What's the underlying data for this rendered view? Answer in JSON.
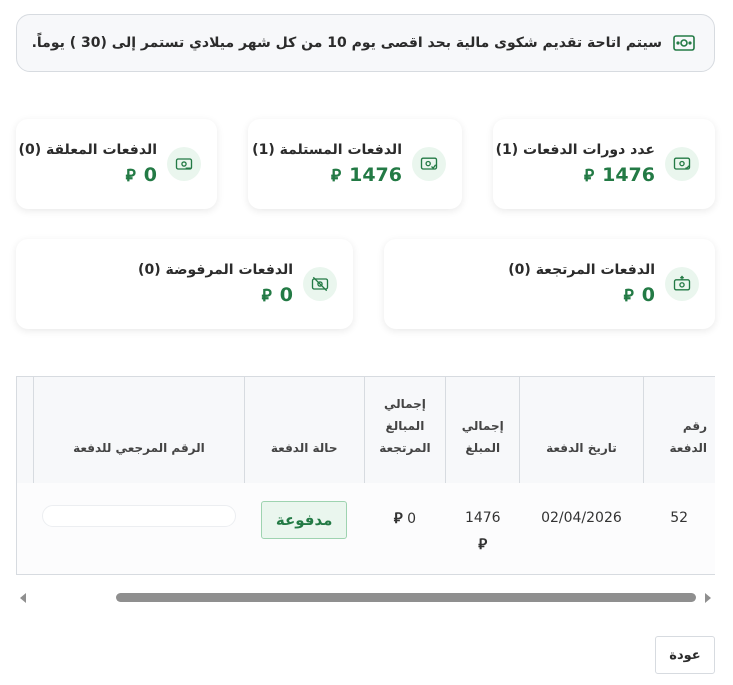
{
  "notice": {
    "text": "سيتم اتاحة تقديم شكوى مالية بحد اقصى يوم 10 من كل شهر ميلادي تستمر إلى (30 ) يوماً.",
    "icon": "cash-icon"
  },
  "currency_symbol": "⃁",
  "stats": [
    {
      "id": "cycles",
      "title": "عدد دورات الدفعات (1)",
      "value": "1476",
      "icon": "cash-cycle-icon"
    },
    {
      "id": "received",
      "title": "الدفعات المستلمة (1)",
      "value": "1476",
      "icon": "cash-check-icon"
    },
    {
      "id": "pending",
      "title": "الدفعات المعلقة (0)",
      "value": "0",
      "icon": "cash-pending-icon"
    },
    {
      "id": "returned",
      "title": "الدفعات المرتجعة (0)",
      "value": "0",
      "icon": "cash-return-icon"
    },
    {
      "id": "rejected",
      "title": "الدفعات المرفوضة (0)",
      "value": "0",
      "icon": "cash-rejected-icon"
    }
  ],
  "table": {
    "headers": {
      "number": "رقم الدفعة",
      "date": "تاريخ الدفعة",
      "total": "إجمالي المبلغ",
      "returned": "إجمالي المبالغ المرتجعة",
      "status": "حالة الدفعة",
      "reference": "الرقم المرجعي للدفعة"
    },
    "rows": [
      {
        "number": "52",
        "date": "02/04/2026",
        "total": "1476",
        "returned": "0",
        "status": "مدفوعة",
        "reference": ""
      }
    ]
  },
  "back_label": "عودة",
  "colors": {
    "accent": "#237a45",
    "badge_bg": "#eaf6ee",
    "border": "#d7dbe0"
  }
}
